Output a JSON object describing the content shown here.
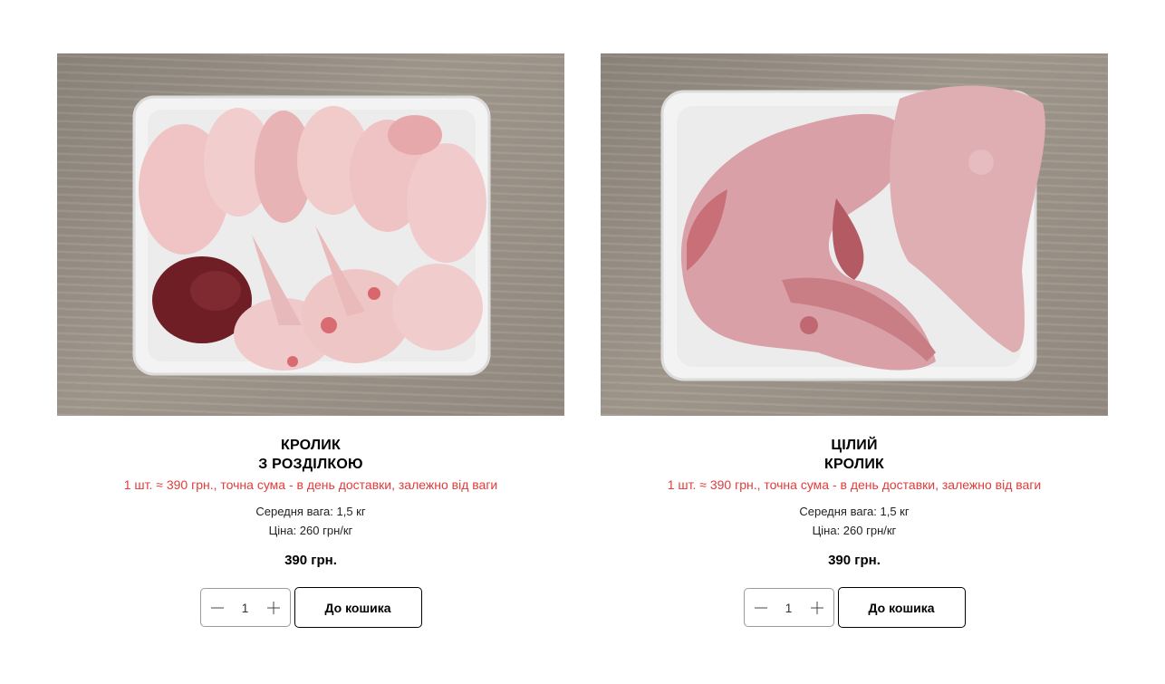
{
  "products": [
    {
      "title_line1": "КРОЛИК",
      "title_line2": "З РОЗДІЛКОЮ",
      "note": "1 шт. ≈ 390 грн., точна сума - в день доставки, залежно від ваги",
      "weight": "Середня вага: 1,5 кг",
      "unit_price": "Ціна: 260 грн/кг",
      "price": "390 грн.",
      "quantity": "1",
      "cart_label": "До кошика",
      "image_alt": "rabbit-cut-on-tray"
    },
    {
      "title_line1": "ЦІЛИЙ",
      "title_line2": "КРОЛИК",
      "note": "1 шт. ≈ 390 грн., точна сума - в день доставки, залежно від ваги",
      "weight": "Середня вага: 1,5 кг",
      "unit_price": "Ціна: 260 грн/кг",
      "price": "390 грн.",
      "quantity": "1",
      "cart_label": "До кошика",
      "image_alt": "whole-rabbit-on-tray"
    }
  ],
  "colors": {
    "accent_red": "#e03c3c",
    "text": "#000000",
    "border_button": "#000000",
    "border_qty": "#9a9a9a"
  },
  "icons": {
    "minus": "minus-icon",
    "plus": "plus-icon"
  }
}
